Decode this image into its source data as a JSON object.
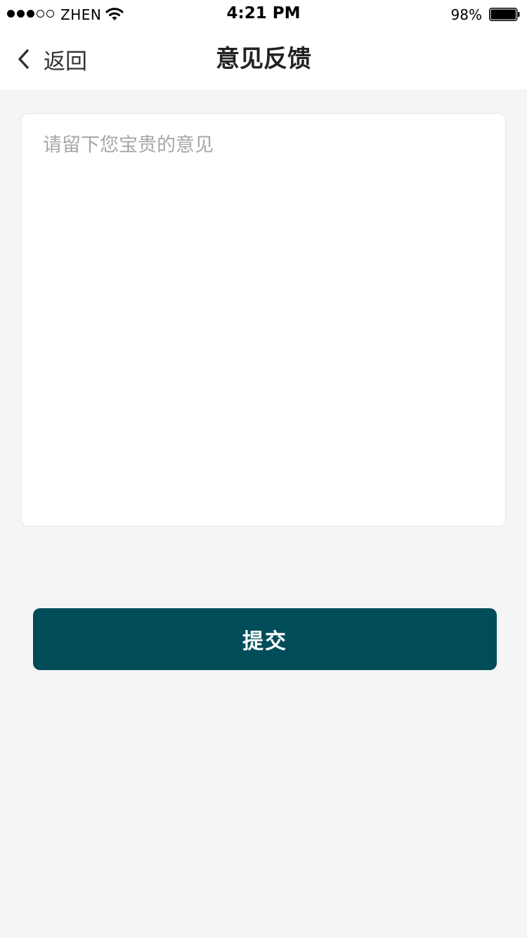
{
  "status_bar": {
    "signal_filled": 3,
    "signal_total": 5,
    "carrier": "ZHEN",
    "time": "4:21 PM",
    "battery_percent": "98%",
    "battery_level": 0.98
  },
  "nav": {
    "back_label": "返回",
    "back_icon": "chevron-left-icon",
    "title": "意见反馈"
  },
  "feedback": {
    "value": "",
    "placeholder": "请留下您宝贵的意见"
  },
  "submit": {
    "label": "提交"
  },
  "colors": {
    "primary": "#004d59",
    "background": "#f5f5f5",
    "surface": "#ffffff",
    "placeholder": "#a6a6a6"
  }
}
